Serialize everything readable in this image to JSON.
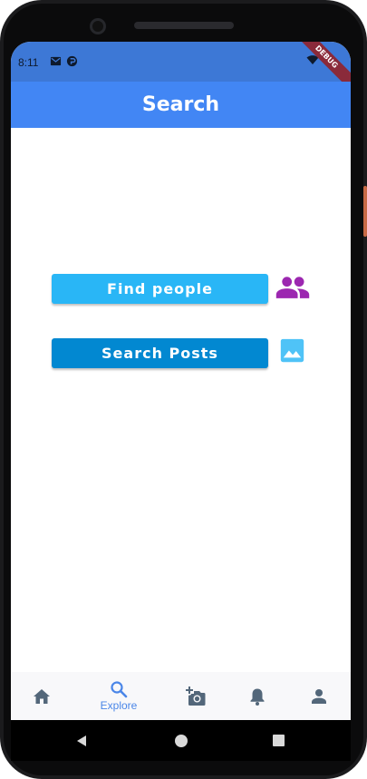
{
  "status_bar": {
    "time": "8:11"
  },
  "debug_banner": "DEBUG",
  "app_bar": {
    "title": "Search"
  },
  "actions": {
    "find_people_label": "Find people",
    "search_posts_label": "Search Posts"
  },
  "bottom_nav": {
    "items": [
      {
        "icon": "home-icon",
        "label": ""
      },
      {
        "icon": "search-icon",
        "label": "Explore",
        "active": true
      },
      {
        "icon": "add-photo-icon",
        "label": ""
      },
      {
        "icon": "bell-icon",
        "label": ""
      },
      {
        "icon": "person-icon",
        "label": ""
      }
    ]
  },
  "colors": {
    "app_bar": "#4286f4",
    "status_bar": "#3d78d6",
    "find_people_button": "#29b6f6",
    "search_posts_button": "#0288d1",
    "people_icon": "#9c27b0",
    "image_icon": "#4fc3f7",
    "nav_inactive": "#53677a",
    "nav_active": "#4a86e8"
  }
}
